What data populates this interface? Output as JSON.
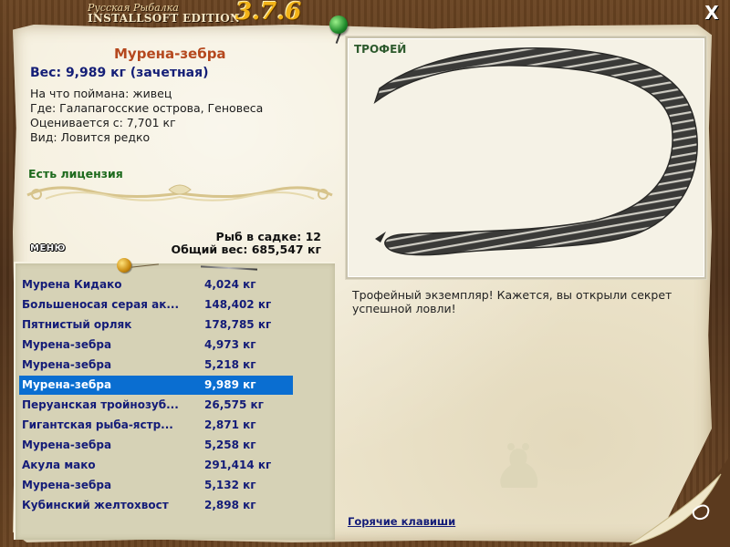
{
  "window": {
    "logo_top": "Русская Рыбалка",
    "logo_bottom": "INSTALLSOFT EDITION",
    "version": "3.7.6",
    "close_label": "X"
  },
  "fish": {
    "name": "Мурена-зебра",
    "weight": "Вес: 9,989 кг (зачетная)",
    "bait": "На что поймана: живец",
    "location": "Где: Галапагосские острова, Геновеса",
    "rated_from": "Оценивается с: 7,701 кг",
    "kind": "Вид: Ловится редко",
    "license": "Есть лицензия"
  },
  "stats": {
    "count": "Рыб в садке: 12",
    "total": "Общий вес: 685,547 кг"
  },
  "menu": {
    "label": "МЕНЮ"
  },
  "list": [
    {
      "name": "Мурена Кидако",
      "weight": "4,024 кг",
      "selected": false
    },
    {
      "name": "Большеносая серая ак...",
      "weight": "148,402 кг",
      "selected": false
    },
    {
      "name": "Пятнистый орляк",
      "weight": "178,785 кг",
      "selected": false
    },
    {
      "name": "Мурена-зебра",
      "weight": "4,973 кг",
      "selected": false
    },
    {
      "name": "Мурена-зебра",
      "weight": "5,218 кг",
      "selected": false
    },
    {
      "name": "Мурена-зебра",
      "weight": "9,989 кг",
      "selected": true
    },
    {
      "name": "Перуанская тройнозуб...",
      "weight": "26,575 кг",
      "selected": false
    },
    {
      "name": "Гигантская рыба-ястр...",
      "weight": "2,871 кг",
      "selected": false
    },
    {
      "name": "Мурена-зебра",
      "weight": "5,258 кг",
      "selected": false
    },
    {
      "name": "Акула мако",
      "weight": "291,414 кг",
      "selected": false
    },
    {
      "name": "Мурена-зебра",
      "weight": "5,132 кг",
      "selected": false
    },
    {
      "name": "Кубинский желтохвост",
      "weight": "2,898 кг",
      "selected": false
    }
  ],
  "trophy": {
    "label": "ТРОФЕЙ",
    "description": "Трофейный экземпляр! Кажется, вы открыли секрет успешной ловли!"
  },
  "hotkeys": {
    "label": "Горячие клавиши"
  },
  "colors": {
    "selection": "#0a6ed1",
    "list_text": "#141c78",
    "title": "#b5481e",
    "license": "#1d6a1d"
  }
}
